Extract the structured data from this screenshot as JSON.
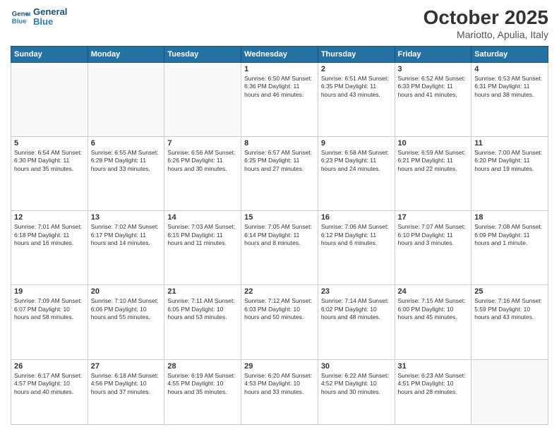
{
  "header": {
    "logo_line1": "General",
    "logo_line2": "Blue",
    "month": "October 2025",
    "location": "Mariotto, Apulia, Italy"
  },
  "weekdays": [
    "Sunday",
    "Monday",
    "Tuesday",
    "Wednesday",
    "Thursday",
    "Friday",
    "Saturday"
  ],
  "weeks": [
    [
      {
        "num": "",
        "info": ""
      },
      {
        "num": "",
        "info": ""
      },
      {
        "num": "",
        "info": ""
      },
      {
        "num": "1",
        "info": "Sunrise: 6:50 AM\nSunset: 6:36 PM\nDaylight: 11 hours\nand 46 minutes."
      },
      {
        "num": "2",
        "info": "Sunrise: 6:51 AM\nSunset: 6:35 PM\nDaylight: 11 hours\nand 43 minutes."
      },
      {
        "num": "3",
        "info": "Sunrise: 6:52 AM\nSunset: 6:33 PM\nDaylight: 11 hours\nand 41 minutes."
      },
      {
        "num": "4",
        "info": "Sunrise: 6:53 AM\nSunset: 6:31 PM\nDaylight: 11 hours\nand 38 minutes."
      }
    ],
    [
      {
        "num": "5",
        "info": "Sunrise: 6:54 AM\nSunset: 6:30 PM\nDaylight: 11 hours\nand 35 minutes."
      },
      {
        "num": "6",
        "info": "Sunrise: 6:55 AM\nSunset: 6:28 PM\nDaylight: 11 hours\nand 33 minutes."
      },
      {
        "num": "7",
        "info": "Sunrise: 6:56 AM\nSunset: 6:26 PM\nDaylight: 11 hours\nand 30 minutes."
      },
      {
        "num": "8",
        "info": "Sunrise: 6:57 AM\nSunset: 6:25 PM\nDaylight: 11 hours\nand 27 minutes."
      },
      {
        "num": "9",
        "info": "Sunrise: 6:58 AM\nSunset: 6:23 PM\nDaylight: 11 hours\nand 24 minutes."
      },
      {
        "num": "10",
        "info": "Sunrise: 6:59 AM\nSunset: 6:21 PM\nDaylight: 11 hours\nand 22 minutes."
      },
      {
        "num": "11",
        "info": "Sunrise: 7:00 AM\nSunset: 6:20 PM\nDaylight: 11 hours\nand 19 minutes."
      }
    ],
    [
      {
        "num": "12",
        "info": "Sunrise: 7:01 AM\nSunset: 6:18 PM\nDaylight: 11 hours\nand 16 minutes."
      },
      {
        "num": "13",
        "info": "Sunrise: 7:02 AM\nSunset: 6:17 PM\nDaylight: 11 hours\nand 14 minutes."
      },
      {
        "num": "14",
        "info": "Sunrise: 7:03 AM\nSunset: 6:15 PM\nDaylight: 11 hours\nand 11 minutes."
      },
      {
        "num": "15",
        "info": "Sunrise: 7:05 AM\nSunset: 6:14 PM\nDaylight: 11 hours\nand 8 minutes."
      },
      {
        "num": "16",
        "info": "Sunrise: 7:06 AM\nSunset: 6:12 PM\nDaylight: 11 hours\nand 6 minutes."
      },
      {
        "num": "17",
        "info": "Sunrise: 7:07 AM\nSunset: 6:10 PM\nDaylight: 11 hours\nand 3 minutes."
      },
      {
        "num": "18",
        "info": "Sunrise: 7:08 AM\nSunset: 6:09 PM\nDaylight: 11 hours\nand 1 minute."
      }
    ],
    [
      {
        "num": "19",
        "info": "Sunrise: 7:09 AM\nSunset: 6:07 PM\nDaylight: 10 hours\nand 58 minutes."
      },
      {
        "num": "20",
        "info": "Sunrise: 7:10 AM\nSunset: 6:06 PM\nDaylight: 10 hours\nand 55 minutes."
      },
      {
        "num": "21",
        "info": "Sunrise: 7:11 AM\nSunset: 6:05 PM\nDaylight: 10 hours\nand 53 minutes."
      },
      {
        "num": "22",
        "info": "Sunrise: 7:12 AM\nSunset: 6:03 PM\nDaylight: 10 hours\nand 50 minutes."
      },
      {
        "num": "23",
        "info": "Sunrise: 7:14 AM\nSunset: 6:02 PM\nDaylight: 10 hours\nand 48 minutes."
      },
      {
        "num": "24",
        "info": "Sunrise: 7:15 AM\nSunset: 6:00 PM\nDaylight: 10 hours\nand 45 minutes."
      },
      {
        "num": "25",
        "info": "Sunrise: 7:16 AM\nSunset: 5:59 PM\nDaylight: 10 hours\nand 43 minutes."
      }
    ],
    [
      {
        "num": "26",
        "info": "Sunrise: 6:17 AM\nSunset: 4:57 PM\nDaylight: 10 hours\nand 40 minutes."
      },
      {
        "num": "27",
        "info": "Sunrise: 6:18 AM\nSunset: 4:56 PM\nDaylight: 10 hours\nand 37 minutes."
      },
      {
        "num": "28",
        "info": "Sunrise: 6:19 AM\nSunset: 4:55 PM\nDaylight: 10 hours\nand 35 minutes."
      },
      {
        "num": "29",
        "info": "Sunrise: 6:20 AM\nSunset: 4:53 PM\nDaylight: 10 hours\nand 33 minutes."
      },
      {
        "num": "30",
        "info": "Sunrise: 6:22 AM\nSunset: 4:52 PM\nDaylight: 10 hours\nand 30 minutes."
      },
      {
        "num": "31",
        "info": "Sunrise: 6:23 AM\nSunset: 4:51 PM\nDaylight: 10 hours\nand 28 minutes."
      },
      {
        "num": "",
        "info": ""
      }
    ]
  ]
}
